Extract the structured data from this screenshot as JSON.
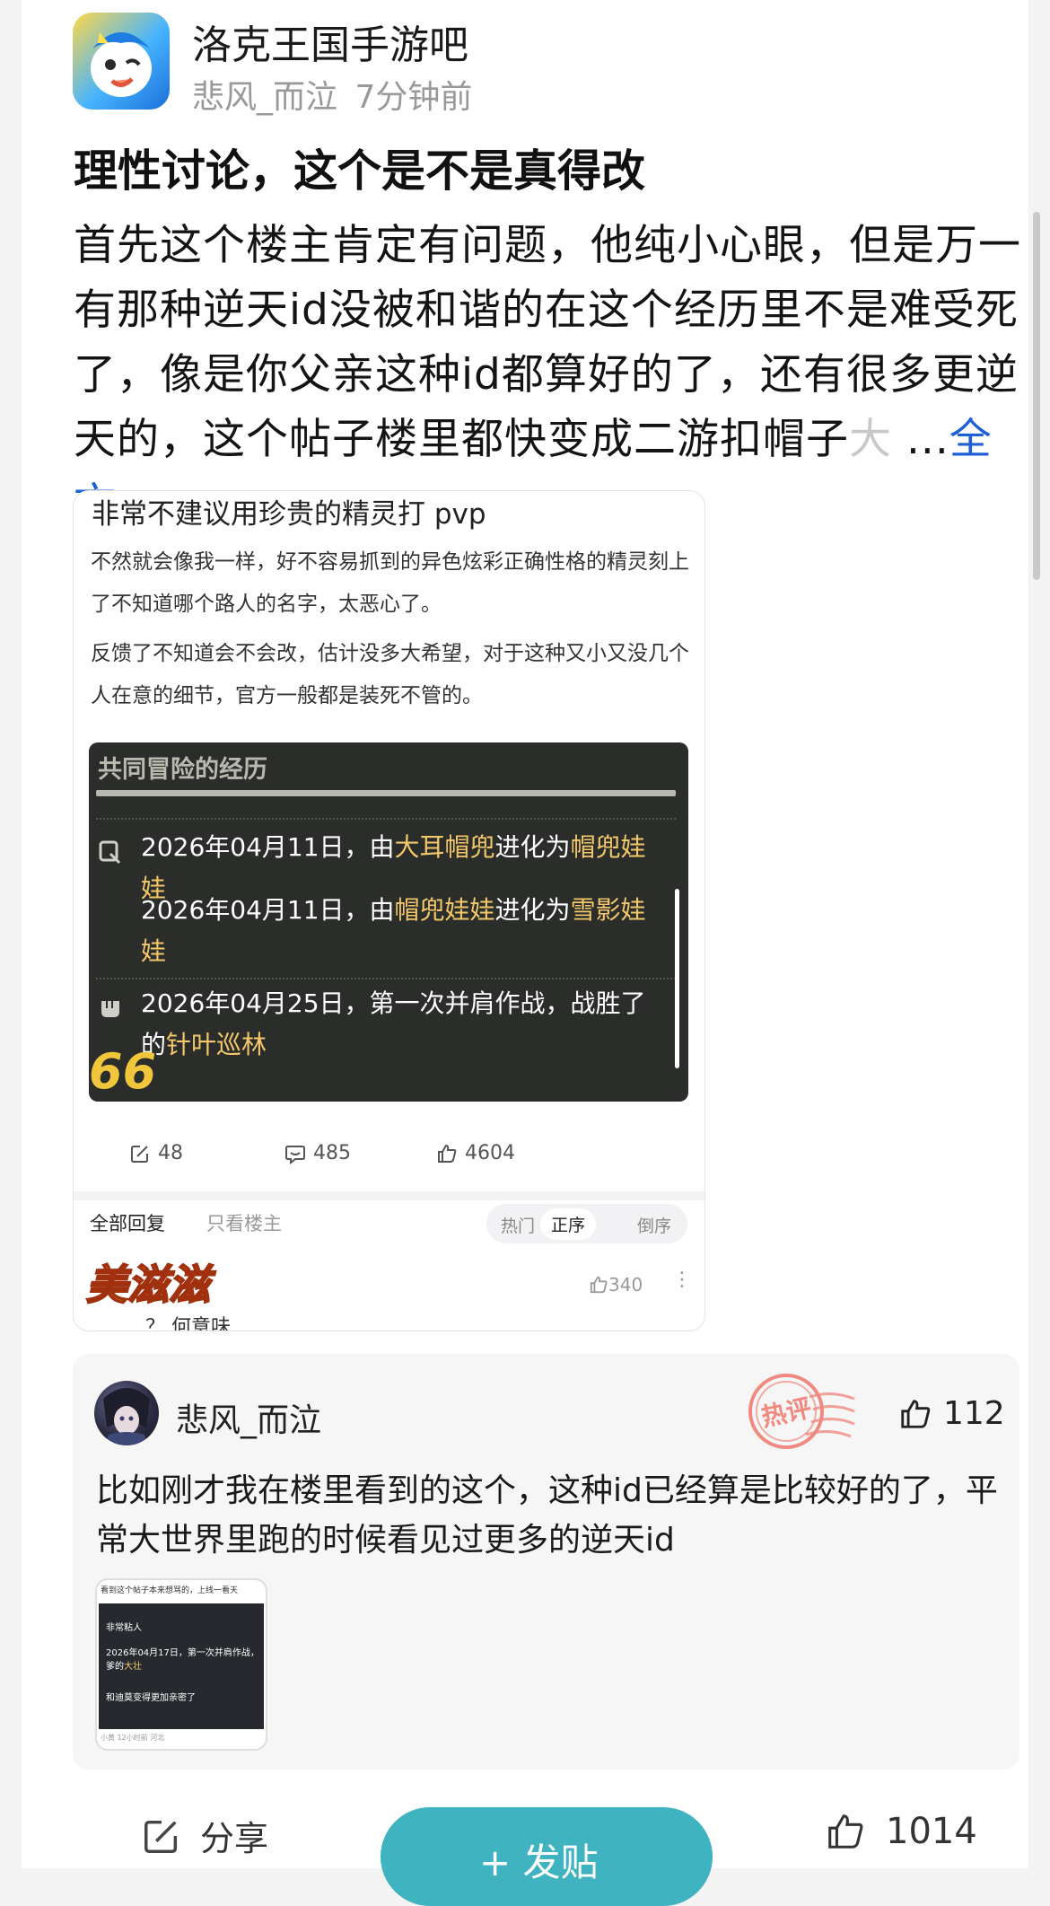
{
  "forum": {
    "name": "洛克王国手游吧"
  },
  "post": {
    "author": "悲风_而泣",
    "time": "7分钟前",
    "title": "理性讨论，这个是不是真得改",
    "body_main": "首先这个楼主肯定有问题，他纯小心眼，但是万一有那种逆天id没被和谐的在这个经历里不是难受死了，像是你父亲这种id都算好的了，还有很多更逆天的，这个帖子楼里都快变成二游扣帽子",
    "body_fade": "大",
    "ellipsis": "...",
    "full_text_link": "全文"
  },
  "embedded": {
    "title": "非常不建议用珍贵的精灵打 pvp",
    "para1": "不然就会像我一样，好不容易抓到的异色炫彩正确性格的精灵刻上了不知道哪个路人的名字，太恶心了。",
    "para2": " 反馈了不知道会不会改，估计没多大希望，对于这种又小又没几个人在意的细节，官方一般都是装死不管的。",
    "game_header": "共同冒险的经历",
    "entry1_a": "2026年04月11日，由",
    "entry1_h1": "大耳帽兜",
    "entry1_b": "进化为",
    "entry1_h2": "帽兜娃娃",
    "entry2_a": "2026年04月11日，由",
    "entry2_h1": "帽兜娃娃",
    "entry2_b": "进化为",
    "entry2_h2": "雪影娃娃",
    "entry3_a": "2026年04月25日，第一次并肩作战，战胜了",
    "entry3_b": "的",
    "entry3_h": "针叶巡林",
    "badge": "66",
    "stat_repost": "48",
    "stat_comment": "485",
    "stat_like": "4604",
    "tab_all": "全部回复",
    "tab_op": "只看楼主",
    "sort_hot": "热门",
    "sort_order": "正序",
    "sort_reverse": "倒序",
    "reply_sticker": "美滋滋",
    "reply_likes": "340",
    "reply_text": "？ 何意味"
  },
  "comment": {
    "author": "悲风_而泣",
    "stamp": "热评",
    "likes": "112",
    "text": "比如刚才我在楼里看到的这个，这种id已经算是比较好的了，平常大世界里跑的时候看见过更多的逆天id",
    "thumb": {
      "top": "看到这个帖子本来想骂的，上线一看天",
      "l1": "非常粘人",
      "l2a": "2026年04月17日，第一次并肩作战，",
      "l2b": "爹的",
      "l2h": "大壮",
      "l3": "和迪莫变得更加亲密了",
      "bottom": "小黄 12小时前 河北"
    }
  },
  "bottom": {
    "share": "分享",
    "post": "+ 发贴",
    "likes": "1014"
  },
  "colors": {
    "accent": "#3fb4c0",
    "link": "#1f5fd6",
    "highlight": "#f3c86a",
    "stamp": "#f08a80"
  }
}
